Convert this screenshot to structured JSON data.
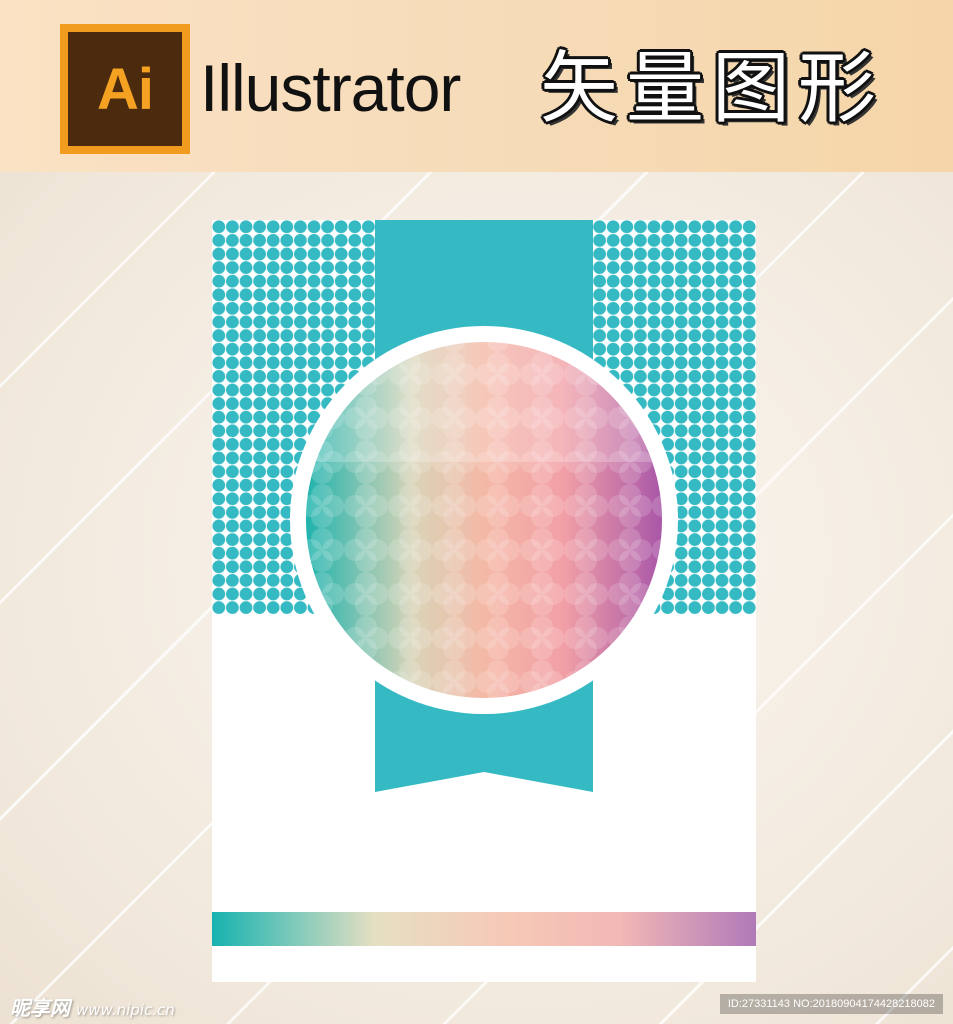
{
  "header": {
    "logo_text": "Ai",
    "app_name": "Illustrator",
    "title_cn": "矢量图形"
  },
  "colors": {
    "teal": "#35bac4",
    "header_bg": "#f8dcb9",
    "badge_orange": "#f19c1e",
    "badge_brown": "#4b2a0d",
    "gradient_stops": [
      "#1fb3ad",
      "#f2d7b6",
      "#f3a9a6",
      "#b57ab8"
    ]
  },
  "artwork": {
    "pattern": "teal-dot-grid",
    "emblem": "gradient-circle-with-petal-grid",
    "ribbon": "teal-ribbon-with-notch",
    "footer_bar": "gradient-strip"
  },
  "watermark": {
    "site_name": "昵享网",
    "site_url": "www.nipic.cn",
    "id_text": "ID:27331143 NO:20180904174428218082"
  }
}
